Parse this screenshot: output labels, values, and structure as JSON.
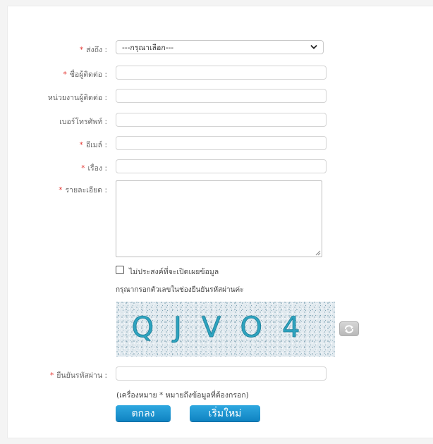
{
  "form": {
    "send_to": {
      "label": "ส่งถึง :",
      "required": true,
      "selected": "---กรุณาเลือก---"
    },
    "contact_name": {
      "label": "ชื่อผู้ติดต่อ :",
      "required": true,
      "value": ""
    },
    "contact_agency": {
      "label": "หน่วยงานผู้ติดต่อ :",
      "required": false,
      "value": ""
    },
    "phone": {
      "label": "เบอร์โทรศัพท์ :",
      "required": false,
      "value": ""
    },
    "email": {
      "label": "อีเมล์ :",
      "required": true,
      "value": ""
    },
    "subject": {
      "label": "เรื่อง :",
      "required": true,
      "value": ""
    },
    "details": {
      "label": "รายละเอียด :",
      "required": true,
      "value": ""
    },
    "hide_identity": {
      "label": "ไม่ประสงค์ที่จะเปิดเผยข้อมูล",
      "checked": false
    },
    "captcha_instruction": "กรุณากรอกตัวเลขในช่องยืนยันรหัสผ่านค่ะ",
    "captcha_text": "QJVO4",
    "captcha_confirm": {
      "label": "ยืนยันรหัสผ่าน :",
      "required": true,
      "value": ""
    },
    "required_note": "(เครื่องหมาย * หมายถึงข้อมูลที่ต้องกรอก)",
    "submit_label": "ตกลง",
    "reset_label": "เริ่มใหม่"
  },
  "required_marker": "*",
  "colors": {
    "required": "#e53935",
    "button": "#1a93d1",
    "captcha_bg": "#dfe8ee",
    "captcha_text": "#2ea3bf"
  },
  "icons": {
    "select_arrow": "chevron-down-icon",
    "captcha_refresh": "refresh-icon"
  }
}
